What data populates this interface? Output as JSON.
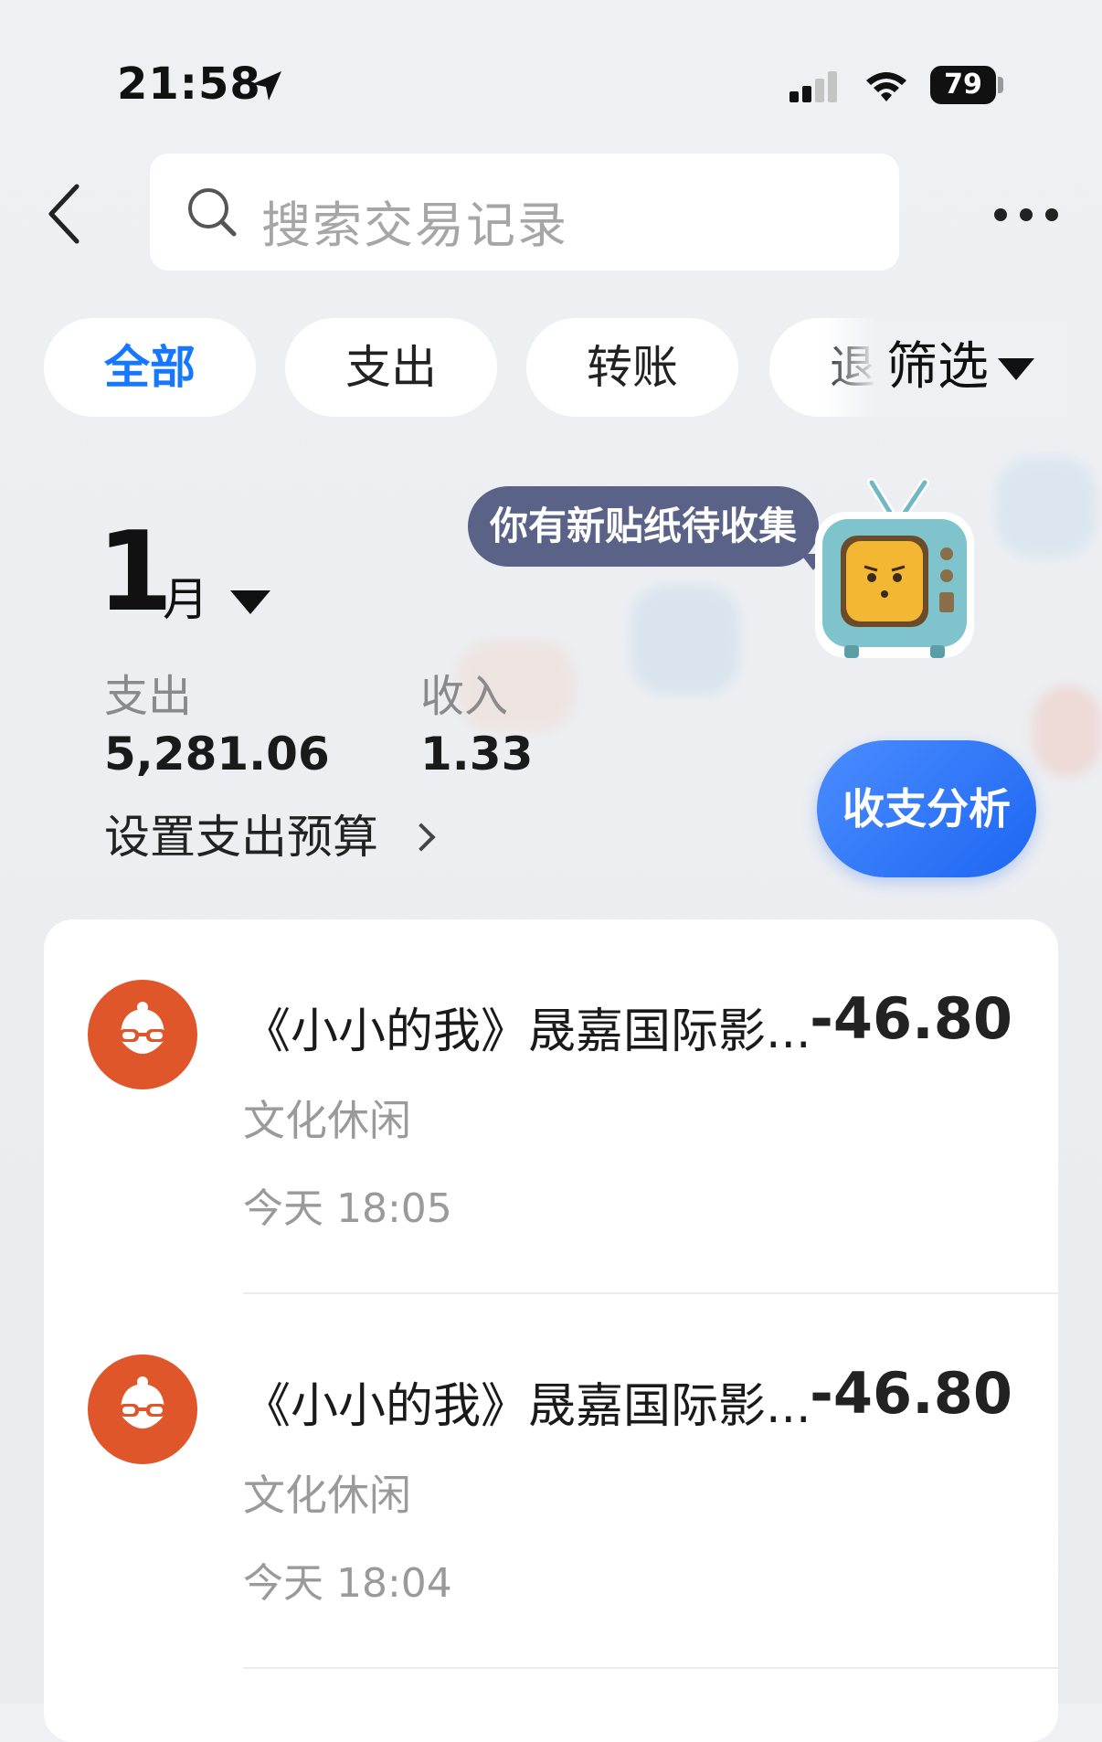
{
  "status_bar": {
    "time": "21:58",
    "battery": "79"
  },
  "search": {
    "placeholder": "搜索交易记录"
  },
  "tabs": [
    {
      "label": "全部",
      "active": true
    },
    {
      "label": "支出",
      "active": false
    },
    {
      "label": "转账",
      "active": false
    },
    {
      "label": "退",
      "active": false
    }
  ],
  "filter": {
    "label": "筛选"
  },
  "summary": {
    "month_number": "1",
    "month_unit": "月",
    "expense_label": "支出",
    "expense_value": "5,281.06",
    "income_label": "收入",
    "income_value": "1.33",
    "budget_link": "设置支出预算"
  },
  "sticker": {
    "bubble_text": "你有新贴纸待收集"
  },
  "analysis_button": "收支分析",
  "colors": {
    "accent": "#1677ff",
    "merchant_icon": "#e0562b",
    "bubble": "#5a6287"
  },
  "transactions": [
    {
      "title": "《小小的我》晟嘉国际影...",
      "amount": "-46.80",
      "category": "文化休闲",
      "time": "今天 18:05",
      "icon": "merchant-glasses-icon"
    },
    {
      "title": "《小小的我》晟嘉国际影...",
      "amount": "-46.80",
      "category": "文化休闲",
      "time": "今天 18:04",
      "icon": "merchant-glasses-icon"
    }
  ]
}
